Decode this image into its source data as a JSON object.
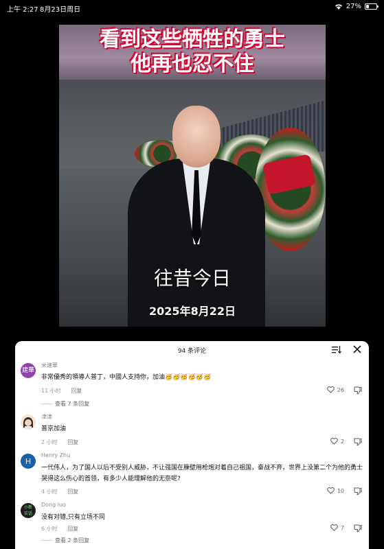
{
  "status_bar": {
    "time": "上午 2:27",
    "date": "8月23日周日",
    "battery": "27%",
    "battery_level": 0.27
  },
  "video": {
    "title_line1": "看到这些牺牲的勇士",
    "title_line2": "他再也忍不住",
    "caption": "往昔今日",
    "date_caption": "2025年8月22日"
  },
  "comments_panel": {
    "count_label": "94 条评论",
    "comments": [
      {
        "username": "米建華",
        "avatar_text": "建華",
        "avatar_color": "#8e44ad",
        "text": "非常優秀的領導人普丁，中國人支持你，加油",
        "emojis": "🥳🥳🥳🥳🥳🥳",
        "time": "11 小时",
        "reply": "回复",
        "likes": "26",
        "expand": "查看 7 条回复"
      },
      {
        "username": "津津",
        "avatar_text": "",
        "avatar_color": "#f1c9b5",
        "text": "普京加油",
        "time": "2 小时",
        "reply": "回复",
        "likes": "2"
      },
      {
        "username": "Henry Zhu",
        "avatar_text": "H",
        "avatar_color": "#1b5fa8",
        "text": "一代伟人，为了国人以后不受别人威胁，不让强国在臊壁用枪炮对着自己祖国，奋战不弃，世界上没第二个为他的勇士哭得这么伤心的首领，有多少人能理解他的无奈呢?",
        "time": "4 小时",
        "reply": "回复",
        "likes": "10"
      },
      {
        "username": "Dong luo",
        "avatar_text": "小新\n实话",
        "avatar_color": "#1d1d1d",
        "text": "没有对错,只有立场不同",
        "time": "6 小时",
        "reply": "回复",
        "likes": "7",
        "expand": "查看 2 条回复"
      }
    ]
  },
  "icons": {
    "wifi": "wifi-icon",
    "battery": "battery-icon",
    "sort": "sort-icon",
    "close": "close-icon",
    "like": "heart-icon",
    "dislike": "thumbs-down-icon"
  }
}
